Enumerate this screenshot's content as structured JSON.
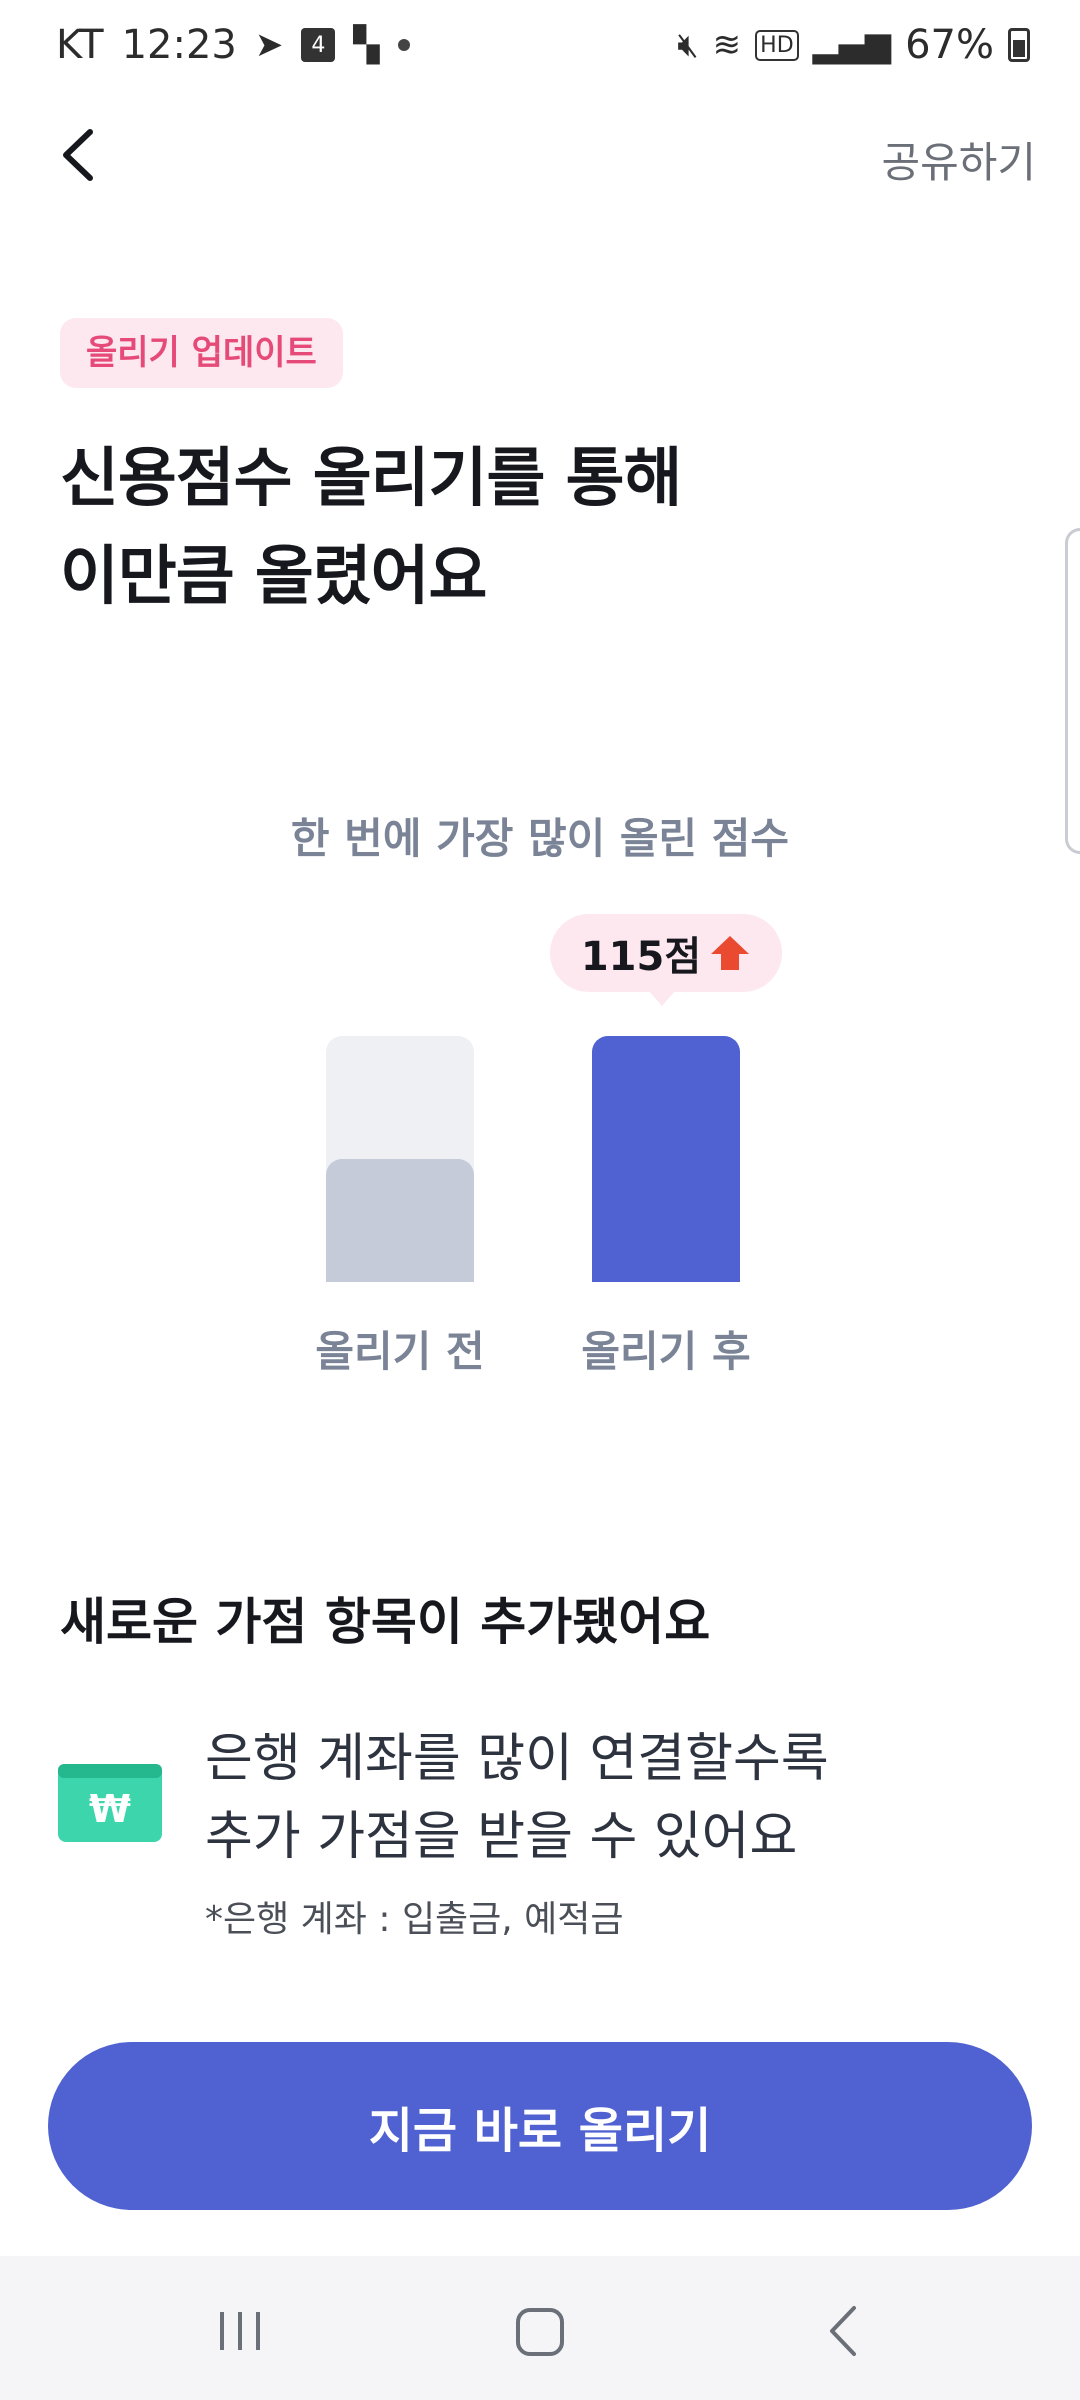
{
  "status_bar": {
    "carrier": "KT",
    "time": "12:23",
    "calendar_day": "4",
    "battery": "67%"
  },
  "nav": {
    "share_label": "공유하기"
  },
  "tag": "올리기 업데이트",
  "headline": {
    "line1": "신용점수 올리기를 통해",
    "line2": "이만큼 올렸어요"
  },
  "chart_data": {
    "type": "bar",
    "title": "한 번에 가장 많이 올린 점수",
    "categories": [
      "올리기 전",
      "올리기 후"
    ],
    "values": [
      0.5,
      1.0
    ],
    "annotation": "115점",
    "colors": {
      "before": "#c6cbd9",
      "after": "#5062d2",
      "track": "#eef0f4"
    }
  },
  "section": {
    "title": "새로운 가점 항목이 추가됐어요",
    "info_line1": "은행 계좌를 많이 연결할수록",
    "info_line2": "추가 가점을 받을 수 있어요",
    "note": "*은행 계좌 : 입출금, 예적금"
  },
  "cta_label": "지금 바로 올리기",
  "colors": {
    "accent": "#5062d2",
    "tag_bg": "#fde8ef",
    "tag_text": "#e54a78",
    "bank_icon": "#3dd6ac",
    "arrow_up": "#ea4a2f"
  }
}
